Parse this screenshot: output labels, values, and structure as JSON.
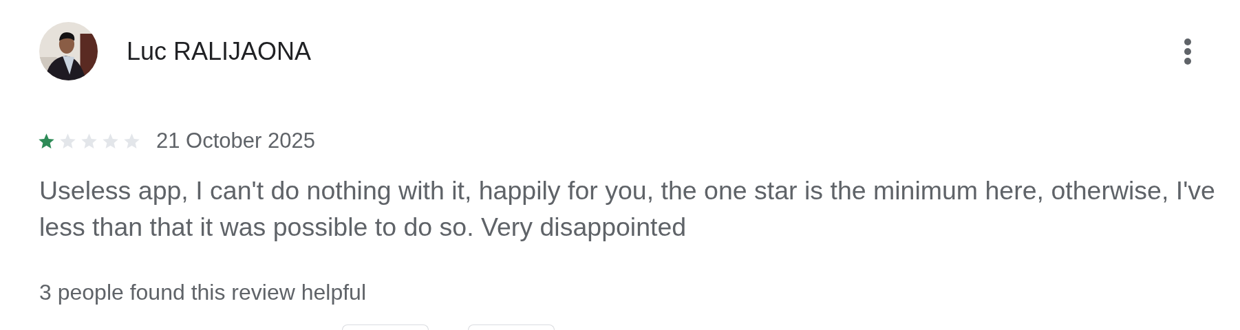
{
  "review": {
    "author": "Luc RALIJAONA",
    "stars": 1,
    "date": "21 October 2025",
    "text": "Useless app, I can't do nothing with it, happily for you, the one star is the minimum here, otherwise, I've less than that it was possible to do so. Very disappointed",
    "helpful": "3 people found this review helpful"
  }
}
